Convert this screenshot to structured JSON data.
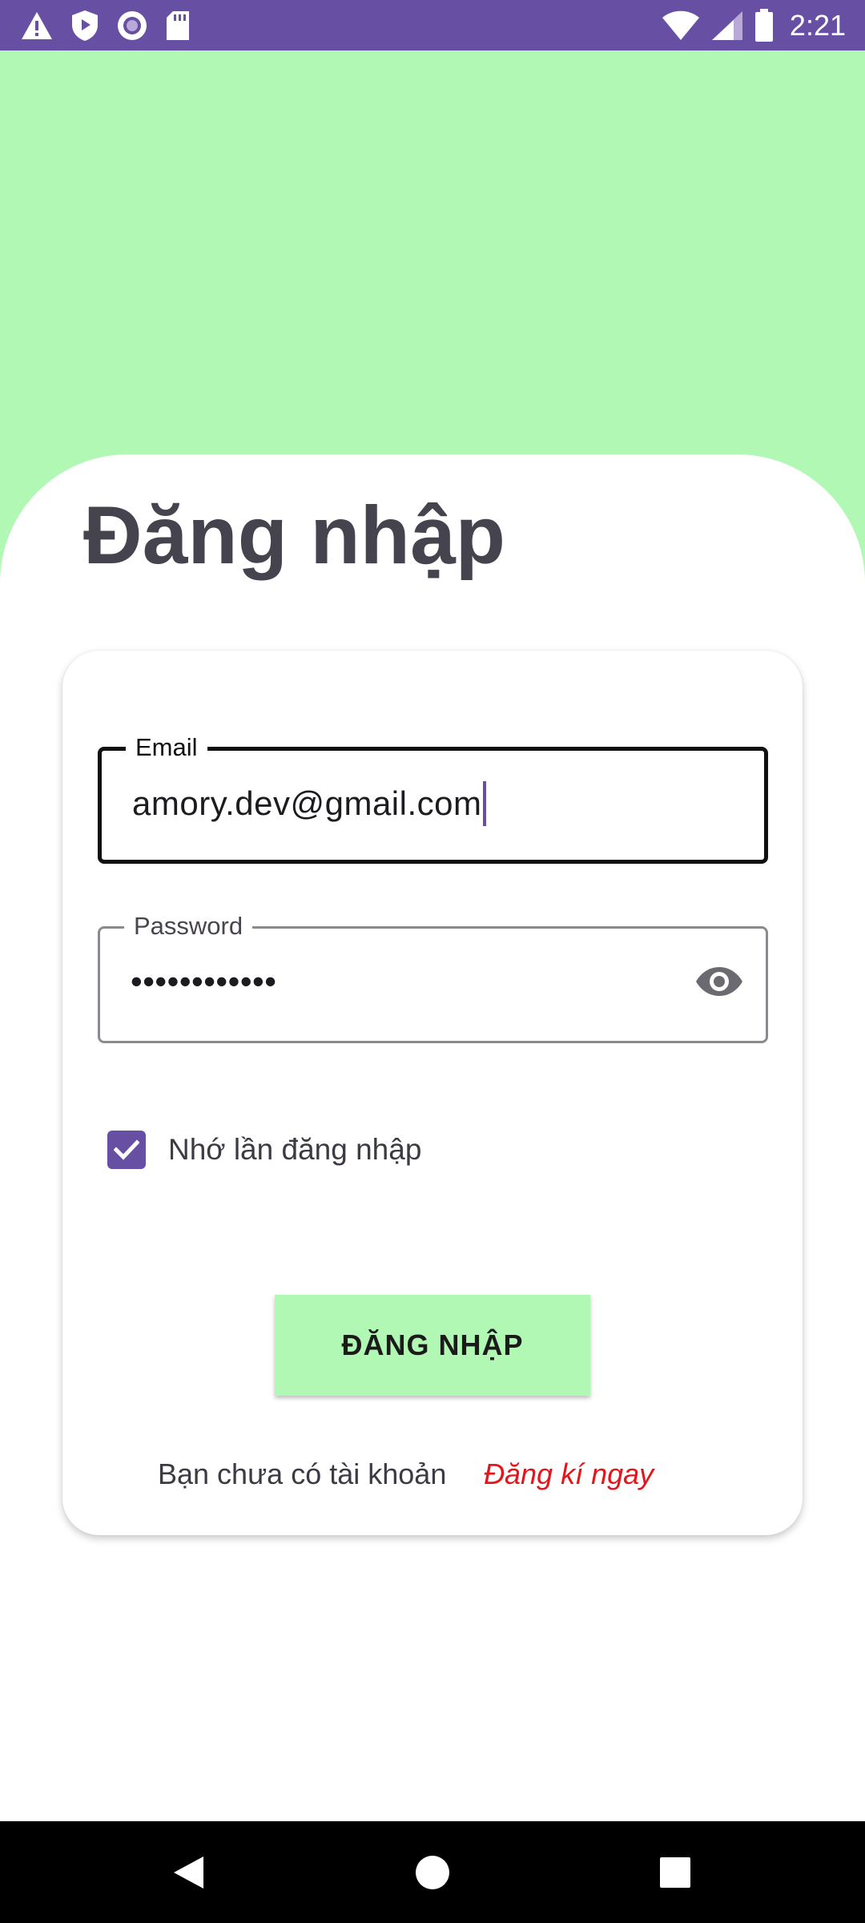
{
  "status_bar": {
    "time": "2:21",
    "icons": [
      "warning-icon",
      "shield-play-icon",
      "record-icon",
      "sd-card-icon",
      "wifi-icon",
      "signal-icon",
      "battery-icon"
    ]
  },
  "login": {
    "title": "Đăng nhập",
    "email": {
      "label": "Email",
      "value": "amory.dev@gmail.com"
    },
    "password": {
      "label": "Password",
      "value": "••••••••••••",
      "toggle_icon": "eye-icon"
    },
    "remember": {
      "label": "Nhớ lần đăng nhập",
      "checked": true
    },
    "submit_label": "ĐĂNG NHẬP",
    "signup_prompt": "Bạn chưa có tài khoản",
    "signup_link": "Đăng kí ngay"
  },
  "nav_bar": {
    "icons": [
      "back-icon",
      "home-icon",
      "recents-icon"
    ]
  },
  "colors": {
    "header_background": "#b1f8b4",
    "status_bar": "#6750a4",
    "accent": "#6750a4",
    "link": "#e4161b",
    "button": "#b1f8b4"
  }
}
